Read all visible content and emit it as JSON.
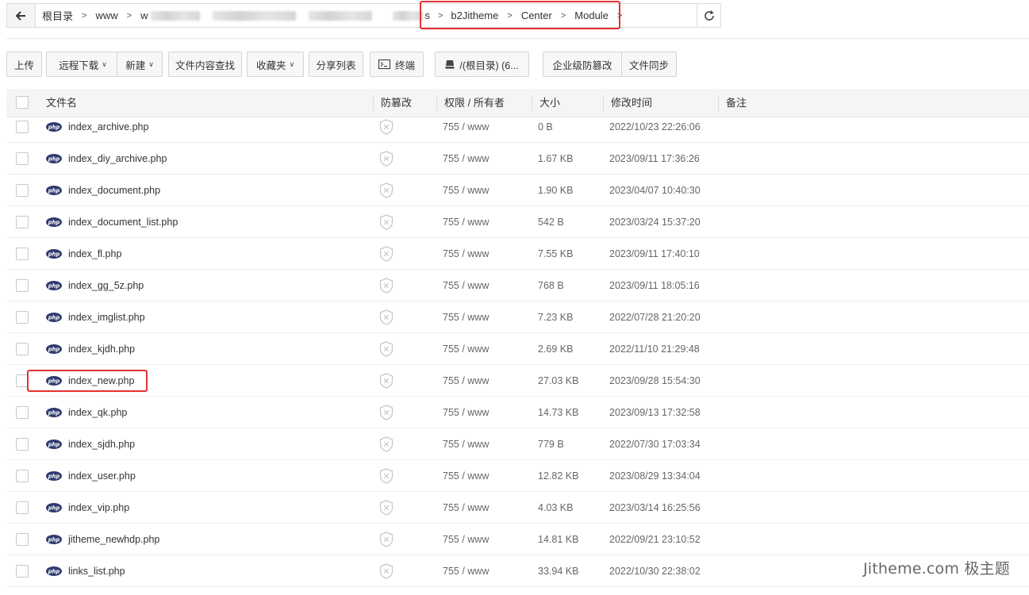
{
  "path": {
    "crumbs": [
      {
        "label": "根目录"
      },
      {
        "label": "www"
      },
      {
        "label": "w"
      },
      {
        "label": "s"
      },
      {
        "label": "b2Jitheme"
      },
      {
        "label": "Center"
      },
      {
        "label": "Module"
      }
    ],
    "back_icon": "arrow-left-icon",
    "refresh_icon": "refresh-icon"
  },
  "toolbar": {
    "upload": "上传",
    "remote_download": "远程下载",
    "new": "新建",
    "content_search": "文件内容查找",
    "favorites": "收藏夹",
    "share_list": "分享列表",
    "terminal": "终端",
    "disk": "/(根目录) (6...",
    "tamper_proof": "企业级防篡改",
    "file_sync": "文件同步"
  },
  "table": {
    "headers": {
      "name": "文件名",
      "tamper": "防篡改",
      "perm": "权限 / 所有者",
      "size": "大小",
      "mtime": "修改时间",
      "note": "备注"
    },
    "rows": [
      {
        "name": "index_archive.php",
        "perm": "755 / www",
        "size": "0 B",
        "mtime": "2022/10/23 22:26:06"
      },
      {
        "name": "index_diy_archive.php",
        "perm": "755 / www",
        "size": "1.67 KB",
        "mtime": "2023/09/11 17:36:26"
      },
      {
        "name": "index_document.php",
        "perm": "755 / www",
        "size": "1.90 KB",
        "mtime": "2023/04/07 10:40:30"
      },
      {
        "name": "index_document_list.php",
        "perm": "755 / www",
        "size": "542 B",
        "mtime": "2023/03/24 15:37:20"
      },
      {
        "name": "index_fl.php",
        "perm": "755 / www",
        "size": "7.55 KB",
        "mtime": "2023/09/11 17:40:10"
      },
      {
        "name": "index_gg_5z.php",
        "perm": "755 / www",
        "size": "768 B",
        "mtime": "2023/09/11 18:05:16"
      },
      {
        "name": "index_imglist.php",
        "perm": "755 / www",
        "size": "7.23 KB",
        "mtime": "2022/07/28 21:20:20"
      },
      {
        "name": "index_kjdh.php",
        "perm": "755 / www",
        "size": "2.69 KB",
        "mtime": "2022/11/10 21:29:48"
      },
      {
        "name": "index_new.php",
        "perm": "755 / www",
        "size": "27.03 KB",
        "mtime": "2023/09/28 15:54:30"
      },
      {
        "name": "index_qk.php",
        "perm": "755 / www",
        "size": "14.73 KB",
        "mtime": "2023/09/13 17:32:58"
      },
      {
        "name": "index_sjdh.php",
        "perm": "755 / www",
        "size": "779 B",
        "mtime": "2022/07/30 17:03:34"
      },
      {
        "name": "index_user.php",
        "perm": "755 / www",
        "size": "12.82 KB",
        "mtime": "2023/08/29 13:34:04"
      },
      {
        "name": "index_vip.php",
        "perm": "755 / www",
        "size": "4.03 KB",
        "mtime": "2023/03/14 16:25:56"
      },
      {
        "name": "jitheme_newhdp.php",
        "perm": "755 / www",
        "size": "14.81 KB",
        "mtime": "2022/09/21 23:10:52"
      },
      {
        "name": "links_list.php",
        "perm": "755 / www",
        "size": "33.94 KB",
        "mtime": "2022/10/30 22:38:02"
      }
    ]
  },
  "watermark": "Jitheme.com 极主题",
  "colors": {
    "highlight": "#e53030",
    "php_icon": "#2f3b6e"
  }
}
